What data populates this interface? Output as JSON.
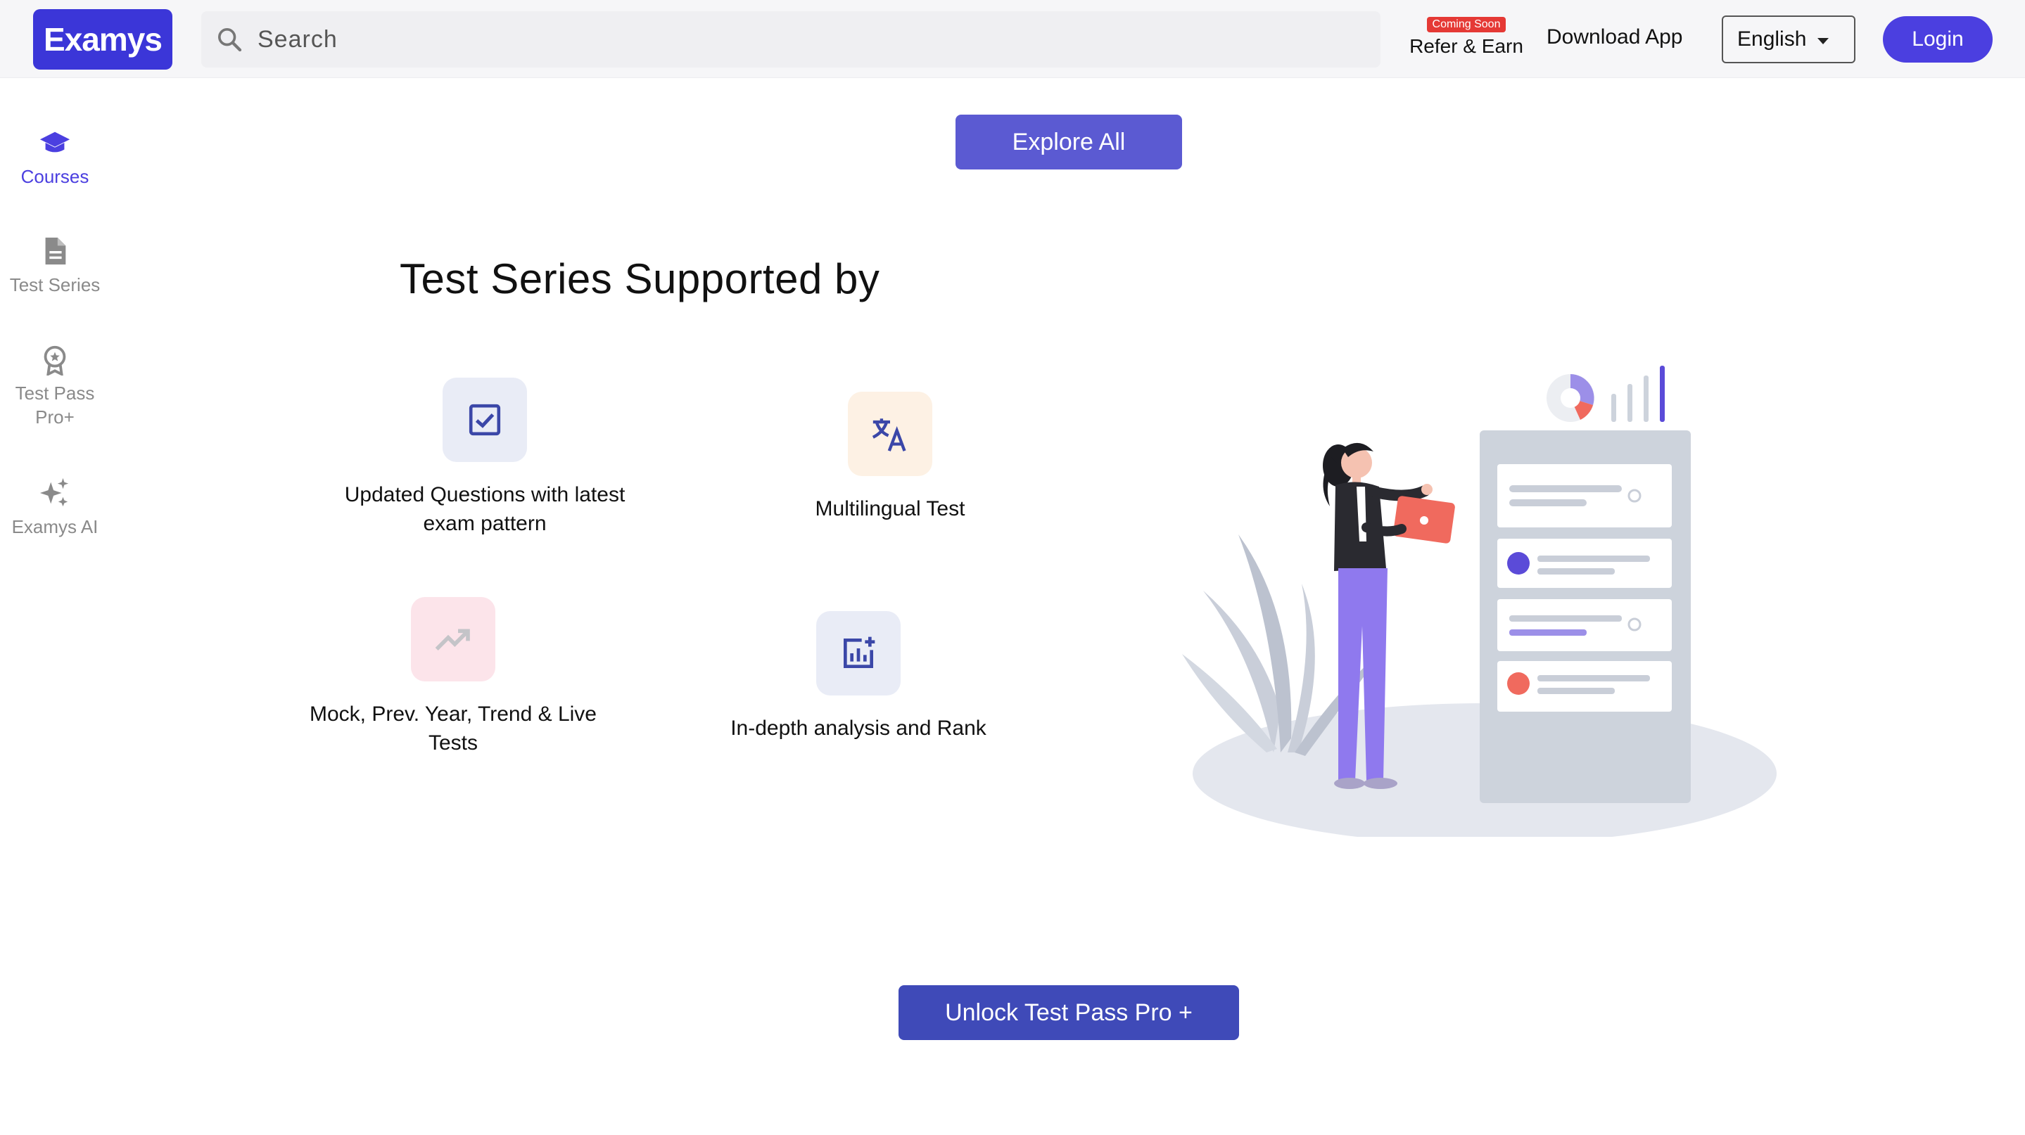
{
  "header": {
    "logo": "Examys",
    "search_placeholder": "Search",
    "coming_soon": "Coming Soon",
    "refer_earn": "Refer & Earn",
    "download_app": "Download App",
    "language": "English",
    "login": "Login"
  },
  "sidebar": {
    "items": [
      {
        "label": "Courses",
        "icon": "graduation-cap-icon",
        "active": true
      },
      {
        "label": "Test Series",
        "icon": "document-icon",
        "active": false
      },
      {
        "label": "Test Pass Pro+",
        "icon": "badge-icon",
        "active": false
      },
      {
        "label": "Examys AI",
        "icon": "sparkles-icon",
        "active": false
      }
    ]
  },
  "main": {
    "explore_all": "Explore All",
    "section_title": "Test Series Supported by",
    "features": [
      {
        "label": "Updated Questions with latest exam pattern",
        "icon": "checkbox-icon",
        "bg": "#e9ecf6"
      },
      {
        "label": "Multilingual Test",
        "icon": "translate-icon",
        "bg": "#fdf1e4"
      },
      {
        "label": "Mock, Prev. Year, Trend & Live Tests",
        "icon": "trending-up-icon",
        "bg": "#fce4ea"
      },
      {
        "label": "In-depth analysis and Rank",
        "icon": "analytics-icon",
        "bg": "#e9ecf6"
      }
    ],
    "unlock": "Unlock Test Pass Pro +"
  },
  "colors": {
    "brand": "#3b36d8",
    "accent": "#4b3fe0",
    "explore_bg": "#5b5ad2",
    "unlock_bg": "#3f4ab8",
    "feature_icon": "#3b47a8",
    "coming_soon_bg": "#e53935"
  }
}
